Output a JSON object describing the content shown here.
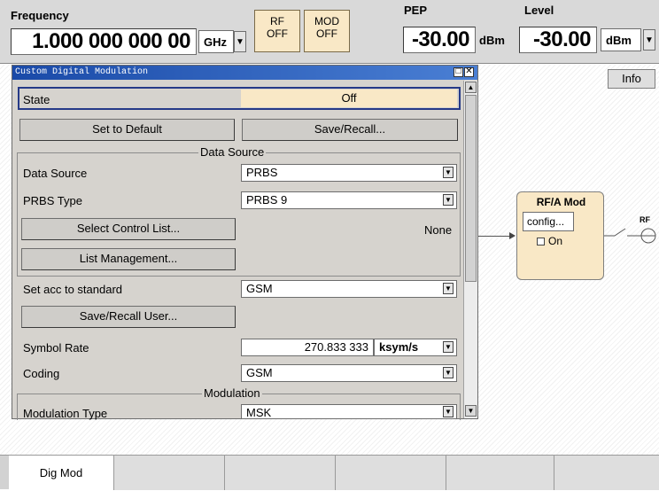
{
  "header": {
    "frequency_label": "Frequency",
    "frequency_value": "1.000 000 000 00",
    "frequency_unit": "GHz",
    "rf_toggle": {
      "line1": "RF",
      "line2": "OFF"
    },
    "mod_toggle": {
      "line1": "MOD",
      "line2": "OFF"
    },
    "pep_label": "PEP",
    "pep_value": "-30.00",
    "pep_unit": "dBm",
    "level_label": "Level",
    "level_value": "-30.00",
    "level_unit": "dBm"
  },
  "info_button": "Info",
  "dialog": {
    "title": "Custom Digital Modulation",
    "state_label": "State",
    "state_value": "Off",
    "set_default": "Set to Default",
    "save_recall": "Save/Recall...",
    "data_source_section": "Data Source",
    "data_source_label": "Data Source",
    "data_source_value": "PRBS",
    "prbs_type_label": "PRBS Type",
    "prbs_type_value": "PRBS 9",
    "select_control_list": "Select Control List...",
    "control_list_value": "None",
    "list_management": "List Management...",
    "set_acc_label": "Set acc to standard",
    "set_acc_value": "GSM",
    "save_recall_user": "Save/Recall User...",
    "symbol_rate_label": "Symbol Rate",
    "symbol_rate_value": "270.833 333",
    "symbol_rate_unit": "ksym/s",
    "coding_label": "Coding",
    "coding_value": "GSM",
    "modulation_section": "Modulation",
    "mod_type_label": "Modulation Type",
    "mod_type_value": "MSK"
  },
  "block": {
    "title": "RF/A Mod",
    "config": "config...",
    "on_label": "On",
    "rf_label": "RF"
  },
  "tabs": [
    "Dig Mod",
    "",
    "",
    "",
    "",
    ""
  ]
}
